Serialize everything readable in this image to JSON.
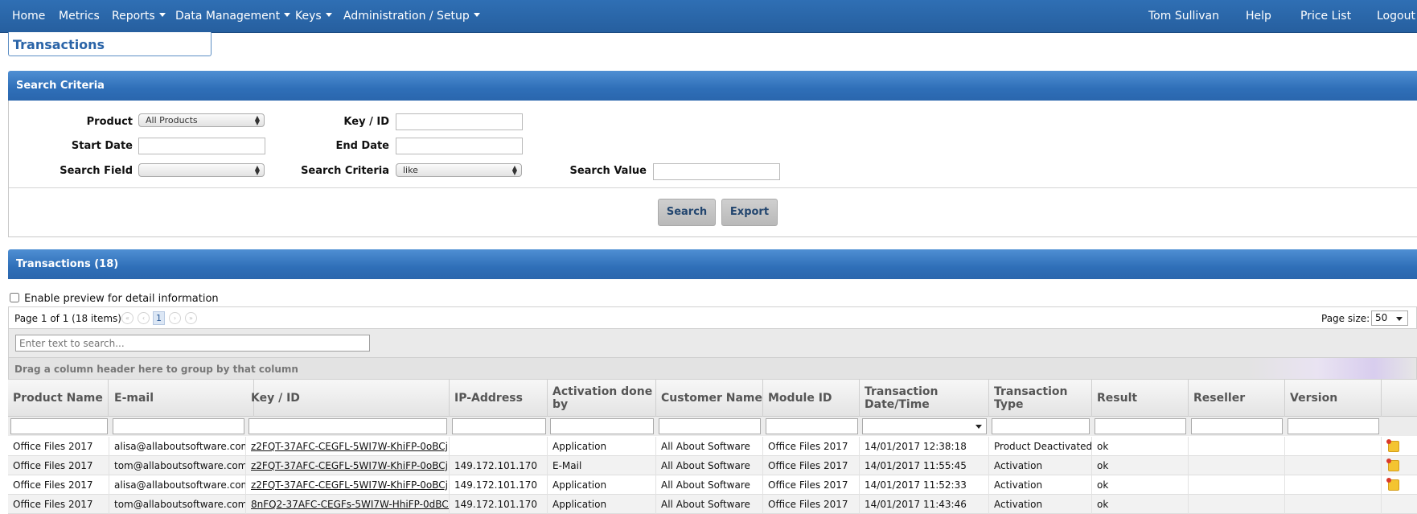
{
  "nav": {
    "home": "Home",
    "metrics": "Metrics",
    "reports": "Reports",
    "data_management": "Data Management",
    "keys": "Keys",
    "admin": "Administration / Setup",
    "user": "Tom Sullivan",
    "help": "Help",
    "price_list": "Price List",
    "logout": "Logout"
  },
  "page_title": "Transactions",
  "search": {
    "header": "Search Criteria",
    "product_label": "Product",
    "product_value": "All Products",
    "key_label": "Key / ID",
    "start_date_label": "Start Date",
    "end_date_label": "End Date",
    "search_field_label": "Search Field",
    "search_field_value": "",
    "criteria_label": "Search Criteria",
    "criteria_value": "like",
    "search_value_label": "Search Value",
    "search_button": "Search",
    "export_button": "Export"
  },
  "grid": {
    "header": "Transactions (18)",
    "preview_label": "Enable preview for detail information",
    "page_info": "Page 1 of 1 (18 items)",
    "current_page": "1",
    "page_size_label": "Page size:",
    "page_size_value": "50",
    "search_placeholder": "Enter text to search...",
    "group_hint": "Drag a column header here to group by that column",
    "columns": [
      "Product Name",
      "E-mail",
      "Key / ID",
      "IP-Address",
      "Activation done by",
      "Customer Name",
      "Module ID",
      "Transaction Date/Time",
      "Transaction Type",
      "Result",
      "Reseller",
      "Version"
    ],
    "rows": [
      {
        "product": "Office Files 2017",
        "email": "alisa@allaboutsoftware.com",
        "key": "z2FQT-37AFC-CEGFL-5WI7W-KhiFP-0oBCj",
        "ip": "",
        "by": "Application",
        "customer": "All About Software",
        "module": "Office Files 2017",
        "datetime": "14/01/2017 12:38:18",
        "type": "Product Deactivated",
        "result": "ok",
        "reseller": "",
        "version": "",
        "note": true
      },
      {
        "product": "Office Files 2017",
        "email": "tom@allaboutsoftware.com",
        "key": "z2FQT-37AFC-CEGFL-5WI7W-KhiFP-0oBCj",
        "ip": "149.172.101.170",
        "by": "E-Mail",
        "customer": "All About Software",
        "module": "Office Files 2017",
        "datetime": "14/01/2017 11:55:45",
        "type": "Activation",
        "result": "ok",
        "reseller": "",
        "version": "",
        "note": true
      },
      {
        "product": "Office Files 2017",
        "email": "alisa@allaboutsoftware.com",
        "key": "z2FQT-37AFC-CEGFL-5WI7W-KhiFP-0oBCj",
        "ip": "149.172.101.170",
        "by": "Application",
        "customer": "All About Software",
        "module": "Office Files 2017",
        "datetime": "14/01/2017 11:52:33",
        "type": "Activation",
        "result": "ok",
        "reseller": "",
        "version": "",
        "note": true
      },
      {
        "product": "Office Files 2017",
        "email": "tom@allaboutsoftware.com",
        "key": "8nFQ2-37AFC-CEGFs-5WI7W-HhiFP-0dBCM",
        "ip": "149.172.101.170",
        "by": "Application",
        "customer": "All About Software",
        "module": "Office Files 2017",
        "datetime": "14/01/2017 11:43:46",
        "type": "Activation",
        "result": "ok",
        "reseller": "",
        "version": "",
        "note": false
      }
    ]
  }
}
